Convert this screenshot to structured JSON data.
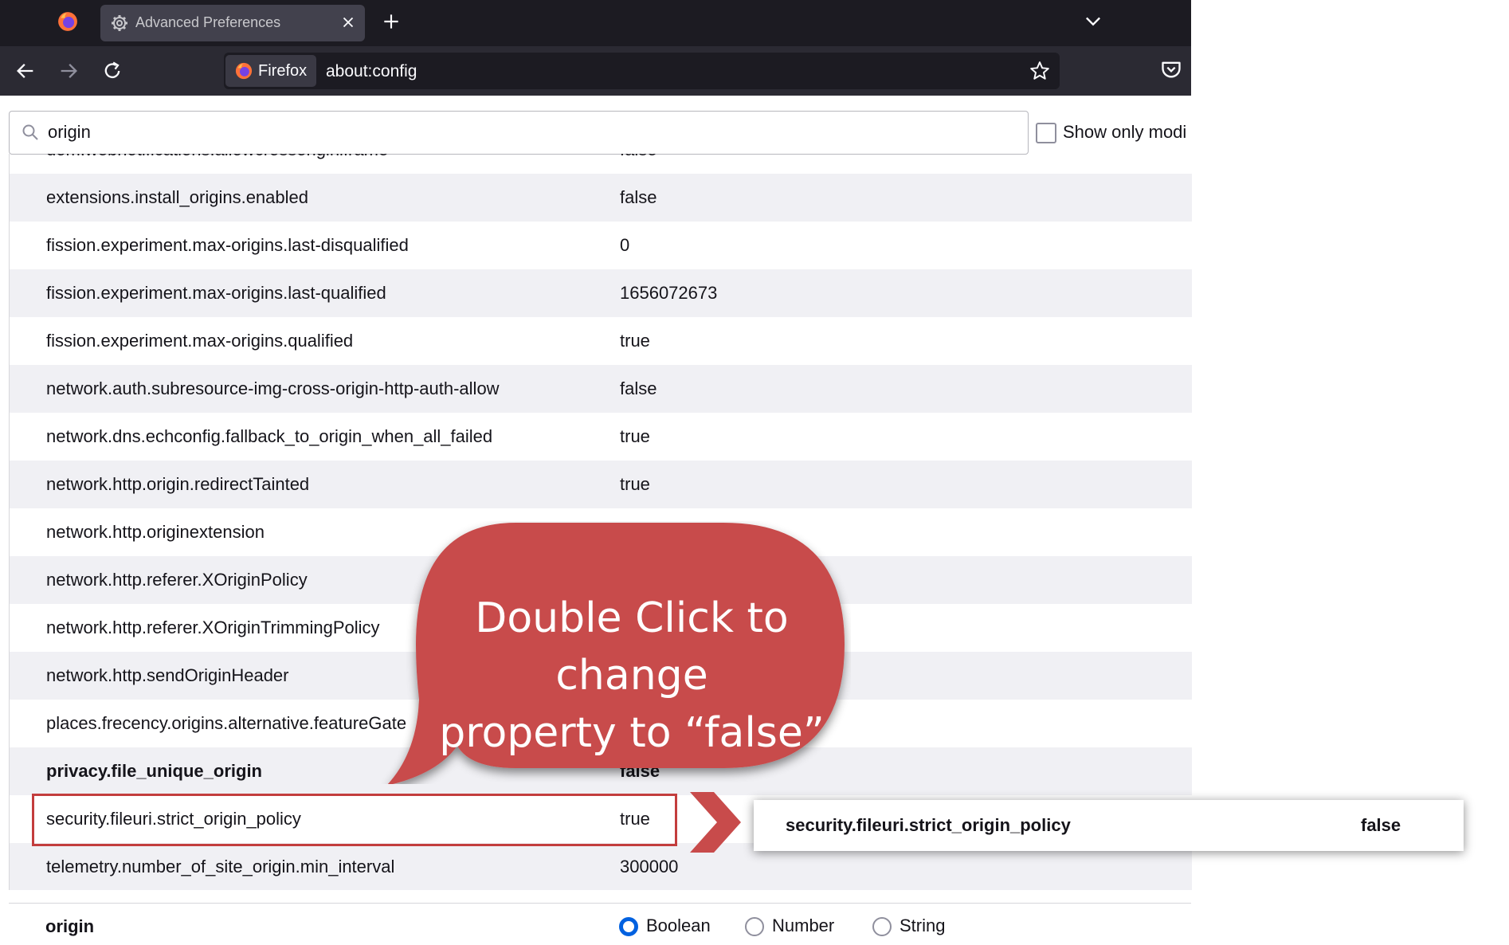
{
  "browser": {
    "tab_title": "Advanced Preferences",
    "identity_label": "Firefox",
    "url": "about:config"
  },
  "config": {
    "search_value": "origin",
    "show_modified_label": "Show only modi",
    "prefs": [
      {
        "name": "dom.webnotifications.allowcrossoriginiframe",
        "value": "false",
        "modified": false
      },
      {
        "name": "extensions.install_origins.enabled",
        "value": "false",
        "modified": false
      },
      {
        "name": "fission.experiment.max-origins.last-disqualified",
        "value": "0",
        "modified": true
      },
      {
        "name": "fission.experiment.max-origins.last-qualified",
        "value": "1656072673",
        "modified": true
      },
      {
        "name": "fission.experiment.max-origins.qualified",
        "value": "true",
        "modified": true
      },
      {
        "name": "network.auth.subresource-img-cross-origin-http-auth-allow",
        "value": "false",
        "modified": false
      },
      {
        "name": "network.dns.echconfig.fallback_to_origin_when_all_failed",
        "value": "true",
        "modified": false
      },
      {
        "name": "network.http.origin.redirectTainted",
        "value": "true",
        "modified": false
      },
      {
        "name": "network.http.originextension",
        "value": "",
        "modified": false
      },
      {
        "name": "network.http.referer.XOriginPolicy",
        "value": "",
        "modified": false
      },
      {
        "name": "network.http.referer.XOriginTrimmingPolicy",
        "value": "",
        "modified": false
      },
      {
        "name": "network.http.sendOriginHeader",
        "value": "",
        "modified": false
      },
      {
        "name": "places.frecency.origins.alternative.featureGate",
        "value": "",
        "modified": false
      },
      {
        "name": "privacy.file_unique_origin",
        "value": "false",
        "modified": true
      },
      {
        "name": "security.fileuri.strict_origin_policy",
        "value": "true",
        "modified": false
      },
      {
        "name": "telemetry.number_of_site_origin.min_interval",
        "value": "300000",
        "modified": false
      }
    ],
    "add_row": {
      "name": "origin",
      "types": [
        "Boolean",
        "Number",
        "String"
      ],
      "selected": "Boolean"
    }
  },
  "annotation": {
    "callout_line1": "Double Click to change",
    "callout_line2": "property to “false”",
    "result_name": "security.fileuri.strict_origin_policy",
    "result_value": "false",
    "accent_color": "#c84b4b"
  }
}
